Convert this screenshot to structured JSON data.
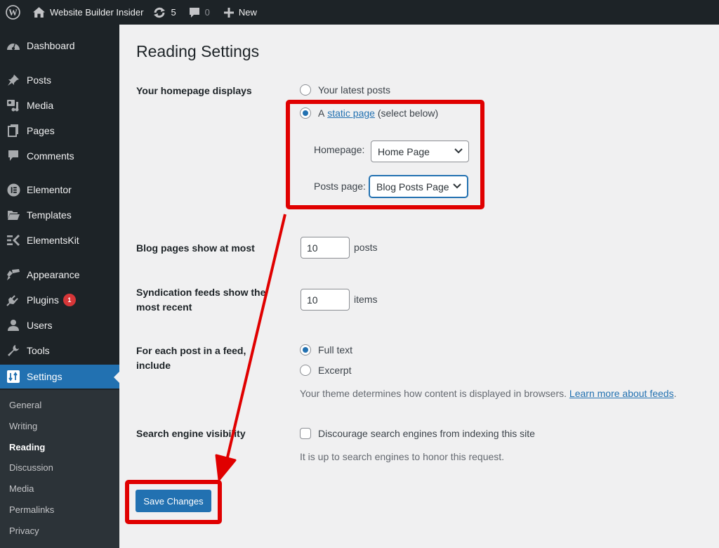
{
  "adminbar": {
    "site_name": "Website Builder Insider",
    "updates_count": "5",
    "comments_count": "0",
    "new_label": "New"
  },
  "sidebar": {
    "items": [
      {
        "label": "Dashboard",
        "icon": "dashboard-icon"
      },
      {
        "label": "Posts",
        "icon": "pin-icon"
      },
      {
        "label": "Media",
        "icon": "media-icon"
      },
      {
        "label": "Pages",
        "icon": "pages-icon"
      },
      {
        "label": "Comments",
        "icon": "comment-icon"
      },
      {
        "label": "Elementor",
        "icon": "elementor-icon"
      },
      {
        "label": "Templates",
        "icon": "folder-icon"
      },
      {
        "label": "ElementsKit",
        "icon": "elementskit-icon"
      },
      {
        "label": "Appearance",
        "icon": "brush-icon"
      },
      {
        "label": "Plugins",
        "icon": "plug-icon",
        "badge": "1"
      },
      {
        "label": "Users",
        "icon": "user-icon"
      },
      {
        "label": "Tools",
        "icon": "wrench-icon"
      },
      {
        "label": "Settings",
        "icon": "settings-icon",
        "active": true
      }
    ],
    "submenu": [
      {
        "label": "General"
      },
      {
        "label": "Writing"
      },
      {
        "label": "Reading",
        "current": true
      },
      {
        "label": "Discussion"
      },
      {
        "label": "Media"
      },
      {
        "label": "Permalinks"
      },
      {
        "label": "Privacy"
      }
    ]
  },
  "page": {
    "title": "Reading Settings",
    "homepage_displays": {
      "label": "Your homepage displays",
      "option_latest": "Your latest posts",
      "option_static_prefix": "A",
      "option_static_link": "static page",
      "option_static_suffix": "(select below)",
      "selected": "static page",
      "homepage_label": "Homepage:",
      "homepage_value": "Home Page",
      "posts_page_label": "Posts page:",
      "posts_page_value": "Blog Posts Page"
    },
    "blog_pages": {
      "label": "Blog pages show at most",
      "value": "10",
      "unit": "posts"
    },
    "syndication": {
      "label": "Syndication feeds show the most recent",
      "value": "10",
      "unit": "items"
    },
    "feed_include": {
      "label": "For each post in a feed, include",
      "option_full": "Full text",
      "option_excerpt": "Excerpt",
      "selected": "Full text",
      "description": "Your theme determines how content is displayed in browsers.",
      "learn_more": "Learn more about feeds",
      "period": "."
    },
    "search_visibility": {
      "label": "Search engine visibility",
      "checkbox_label": "Discourage search engines from indexing this site",
      "checked": false,
      "description": "It is up to search engines to honor this request."
    },
    "save_button": "Save Changes"
  },
  "annotation": {
    "color": "#e00000"
  }
}
